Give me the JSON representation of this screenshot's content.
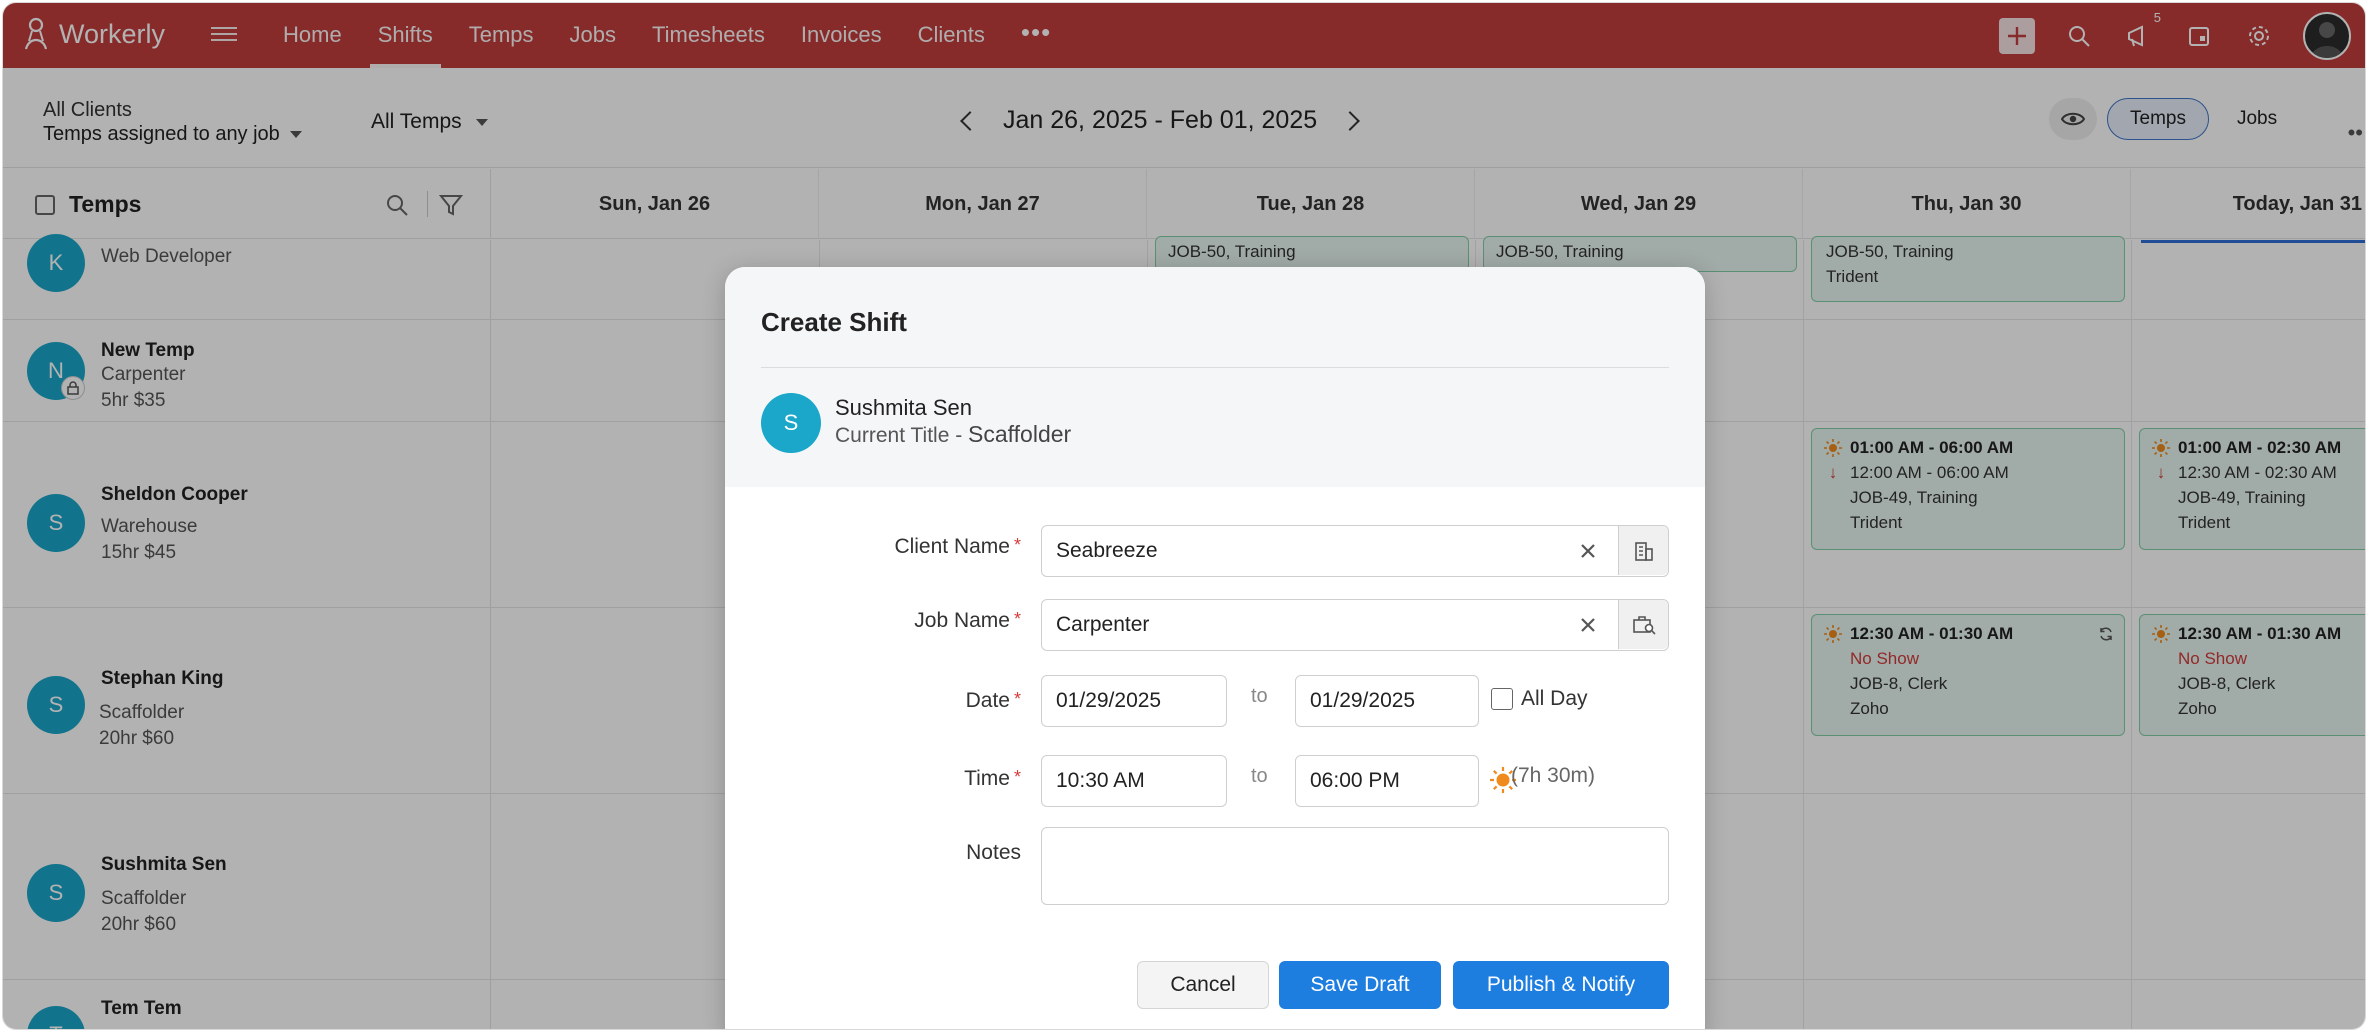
{
  "app": {
    "name": "Workerly"
  },
  "nav": {
    "items": [
      "Home",
      "Shifts",
      "Temps",
      "Jobs",
      "Timesheets",
      "Invoices",
      "Clients"
    ],
    "active": "Shifts",
    "more": "•••",
    "notification_count": "5"
  },
  "filters": {
    "clients_line1": "All Clients",
    "clients_line2": "Temps assigned to any job",
    "temps": "All Temps",
    "date_range": "Jan 26, 2025 - Feb 01, 2025"
  },
  "view_toggle": {
    "temps": "Temps",
    "jobs": "Jobs"
  },
  "grid": {
    "temps_header": "Temps",
    "days": [
      "Sun, Jan 26",
      "Mon, Jan 27",
      "Tue, Jan 28",
      "Wed, Jan 29",
      "Thu, Jan 30",
      "Today, Jan 31"
    ],
    "temps": [
      {
        "initial": "K",
        "name": "",
        "role": "Web Developer",
        "meta": ""
      },
      {
        "initial": "N",
        "name": "New Temp",
        "role": "Carpenter",
        "meta": "5hr $35"
      },
      {
        "initial": "S",
        "name": "Sheldon Cooper",
        "role": "Warehouse",
        "meta": "15hr $45"
      },
      {
        "initial": "S",
        "name": "Stephan King",
        "role": "Scaffolder",
        "meta": "20hr $60"
      },
      {
        "initial": "S",
        "name": "Sushmita Sen",
        "role": "Scaffolder",
        "meta": "20hr $60"
      },
      {
        "initial": "T",
        "name": "Tem Tem",
        "role": "",
        "meta": ""
      }
    ],
    "shifts": {
      "row0": [
        {
          "line1": "JOB-50, Training"
        },
        {
          "line1": "JOB-50, Training"
        },
        {
          "line1": "JOB-50, Training",
          "line2": "Trident"
        }
      ],
      "row2_thu": {
        "time": "01:00 AM - 06:00 AM",
        "actual": "12:00 AM - 06:00 AM",
        "job": "JOB-49, Training",
        "client": "Trident"
      },
      "row2_fri": {
        "time": "01:00 AM - 02:30 AM",
        "actual": "12:30 AM - 02:30 AM",
        "job": "JOB-49, Training",
        "client": "Trident"
      },
      "row3_thu": {
        "time": "12:30 AM - 01:30 AM",
        "status": "No Show",
        "job": "JOB-8, Clerk",
        "client": "Zoho"
      },
      "row3_fri": {
        "time": "12:30 AM - 01:30 AM",
        "status": "No Show",
        "job": "JOB-8, Clerk",
        "client": "Zoho"
      }
    }
  },
  "modal": {
    "title": "Create Shift",
    "temp": {
      "initial": "S",
      "name": "Sushmita Sen",
      "title_label": "Current Title - ",
      "title_value": "Scaffolder"
    },
    "labels": {
      "client": "Client Name",
      "job": "Job Name",
      "date": "Date",
      "time": "Time",
      "notes": "Notes",
      "to": "to",
      "all_day": "All Day",
      "required": "*"
    },
    "values": {
      "client": "Seabreeze",
      "job": "Carpenter",
      "date_from": "01/29/2025",
      "date_to": "01/29/2025",
      "time_from": "10:30 AM",
      "time_to": "06:00 PM",
      "duration": "(7h 30m)",
      "notes": ""
    },
    "buttons": {
      "cancel": "Cancel",
      "save_draft": "Save Draft",
      "publish": "Publish & Notify"
    }
  },
  "colors": {
    "brand": "#c23d3d",
    "accent": "#1e7ee0",
    "avatar": "#1aa7c9",
    "shift_bg": "#e7f5ef",
    "shift_border": "#83cfa8",
    "alert": "#d23b3b"
  }
}
